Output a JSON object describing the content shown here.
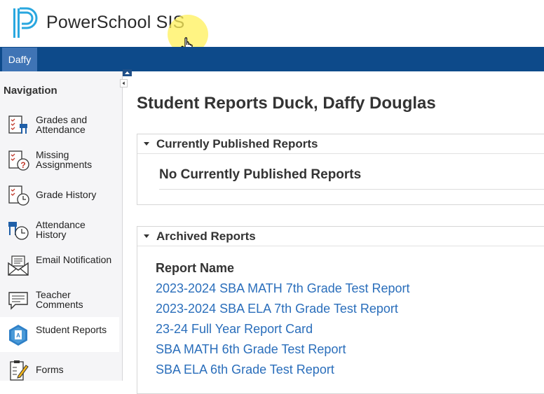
{
  "app": {
    "logo_text": "PowerSchool SIS"
  },
  "student_tab": {
    "label": "Daffy"
  },
  "navigation": {
    "title": "Navigation",
    "items": [
      {
        "label": "Grades and Attendance",
        "icon": "grades-attendance-icon"
      },
      {
        "label": "Missing Assignments",
        "icon": "missing-assignments-icon"
      },
      {
        "label": "Grade History",
        "icon": "grade-history-icon"
      },
      {
        "label": "Attendance History",
        "icon": "attendance-history-icon"
      },
      {
        "label": "Email Notification",
        "icon": "email-notification-icon"
      },
      {
        "label": "Teacher Comments",
        "icon": "teacher-comments-icon"
      },
      {
        "label": "Student Reports",
        "icon": "student-reports-icon",
        "active": true
      },
      {
        "label": "Forms",
        "icon": "forms-icon"
      }
    ]
  },
  "main": {
    "title": "Student Reports Duck, Daffy Douglas",
    "published": {
      "title": "Currently Published Reports",
      "empty_message": "No Currently Published Reports"
    },
    "archived": {
      "title": "Archived Reports",
      "column_header": "Report Name",
      "reports": [
        "2023-2024 SBA MATH 7th Grade Test Report",
        "2023-2024 SBA ELA 7th Grade Test Report",
        "23-24 Full Year Report Card",
        "SBA MATH 6th Grade Test Report",
        "SBA ELA 6th Grade Test Report"
      ]
    }
  },
  "colors": {
    "brand_blue": "#0d4a8a",
    "tab_blue": "#3f74b5",
    "link": "#2a6ebb"
  }
}
